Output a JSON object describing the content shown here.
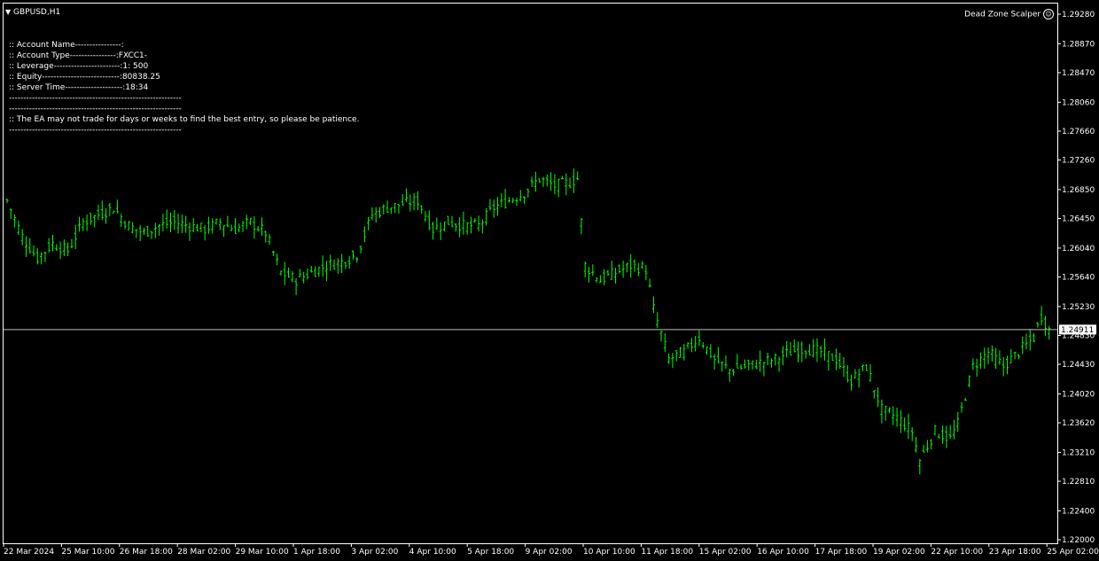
{
  "window": {
    "symbol": "GBPUSD,H1",
    "ea_name": "Dead Zone Scalper",
    "ea_icon": "smiley-icon"
  },
  "info_panel": {
    "lines": [
      ":: Account Name----------------:",
      ":: Account Type----------------:FXCC1-",
      ":: Leverage-----------------------:1: 500",
      ":: Equity---------------------------:80838.25",
      ":: Server Time--------------------:18:34",
      "------------------------------------------------------------",
      "------------------------------------------------------------",
      ":: The EA may not trade for days or weeks to find the best entry, so please be patience.",
      "------------------------------------------------------------"
    ]
  },
  "colors": {
    "background": "#000000",
    "bars": "#00ff00",
    "axis": "#ffffff",
    "current_price_line": "#c0c0c0"
  },
  "chart_data": {
    "type": "ohlc",
    "symbol": "GBPUSD",
    "timeframe": "H1",
    "current_price": "1.24911",
    "ylim": [
      1.22,
      1.2928
    ],
    "y_ticks": [
      "1.29280",
      "1.28870",
      "1.28470",
      "1.28060",
      "1.27660",
      "1.27260",
      "1.26850",
      "1.26450",
      "1.26040",
      "1.25640",
      "1.25230",
      "1.24830",
      "1.24430",
      "1.24020",
      "1.23620",
      "1.23210",
      "1.22810",
      "1.22400",
      "1.22000"
    ],
    "x_ticks": [
      "22 Mar 2024",
      "25 Mar 10:00",
      "26 Mar 18:00",
      "28 Mar 02:00",
      "29 Mar 10:00",
      "1 Apr 18:00",
      "3 Apr 02:00",
      "4 Apr 10:00",
      "5 Apr 18:00",
      "9 Apr 02:00",
      "10 Apr 10:00",
      "11 Apr 18:00",
      "15 Apr 02:00",
      "16 Apr 10:00",
      "17 Apr 18:00",
      "19 Apr 02:00",
      "22 Apr 10:00",
      "23 Apr 18:00",
      "25 Apr 02:00"
    ],
    "close_path": [
      [
        0,
        1.267
      ],
      [
        4,
        1.262
      ],
      [
        8,
        1.259
      ],
      [
        12,
        1.261
      ],
      [
        16,
        1.26
      ],
      [
        20,
        1.264
      ],
      [
        24,
        1.265
      ],
      [
        28,
        1.266
      ],
      [
        32,
        1.2635
      ],
      [
        36,
        1.2625
      ],
      [
        40,
        1.2635
      ],
      [
        44,
        1.264
      ],
      [
        48,
        1.2635
      ],
      [
        52,
        1.263
      ],
      [
        56,
        1.264
      ],
      [
        60,
        1.263
      ],
      [
        64,
        1.264
      ],
      [
        68,
        1.2625
      ],
      [
        72,
        1.257
      ],
      [
        76,
        1.256
      ],
      [
        80,
        1.257
      ],
      [
        84,
        1.258
      ],
      [
        88,
        1.2585
      ],
      [
        92,
        1.2595
      ],
      [
        96,
        1.265
      ],
      [
        100,
        1.266
      ],
      [
        104,
        1.2665
      ],
      [
        108,
        1.267
      ],
      [
        112,
        1.263
      ],
      [
        116,
        1.264
      ],
      [
        120,
        1.2635
      ],
      [
        124,
        1.2635
      ],
      [
        128,
        1.266
      ],
      [
        132,
        1.267
      ],
      [
        136,
        1.268
      ],
      [
        140,
        1.27
      ],
      [
        144,
        1.269
      ],
      [
        148,
        1.2695
      ],
      [
        150,
        1.27
      ],
      [
        152,
        1.258
      ],
      [
        156,
        1.256
      ],
      [
        160,
        1.257
      ],
      [
        164,
        1.258
      ],
      [
        168,
        1.2575
      ],
      [
        170,
        1.252
      ],
      [
        174,
        1.245
      ],
      [
        178,
        1.246
      ],
      [
        182,
        1.248
      ],
      [
        186,
        1.245
      ],
      [
        190,
        1.2435
      ],
      [
        194,
        1.244
      ],
      [
        198,
        1.2445
      ],
      [
        202,
        1.245
      ],
      [
        206,
        1.246
      ],
      [
        210,
        1.2465
      ],
      [
        214,
        1.246
      ],
      [
        218,
        1.245
      ],
      [
        222,
        1.242
      ],
      [
        226,
        1.244
      ],
      [
        230,
        1.238
      ],
      [
        234,
        1.237
      ],
      [
        238,
        1.235
      ],
      [
        240,
        1.231
      ],
      [
        244,
        1.235
      ],
      [
        248,
        1.234
      ],
      [
        250,
        1.236
      ],
      [
        254,
        1.244
      ],
      [
        258,
        1.246
      ],
      [
        262,
        1.244
      ],
      [
        266,
        1.246
      ],
      [
        270,
        1.248
      ],
      [
        272,
        1.251
      ],
      [
        274,
        1.2491
      ]
    ]
  }
}
